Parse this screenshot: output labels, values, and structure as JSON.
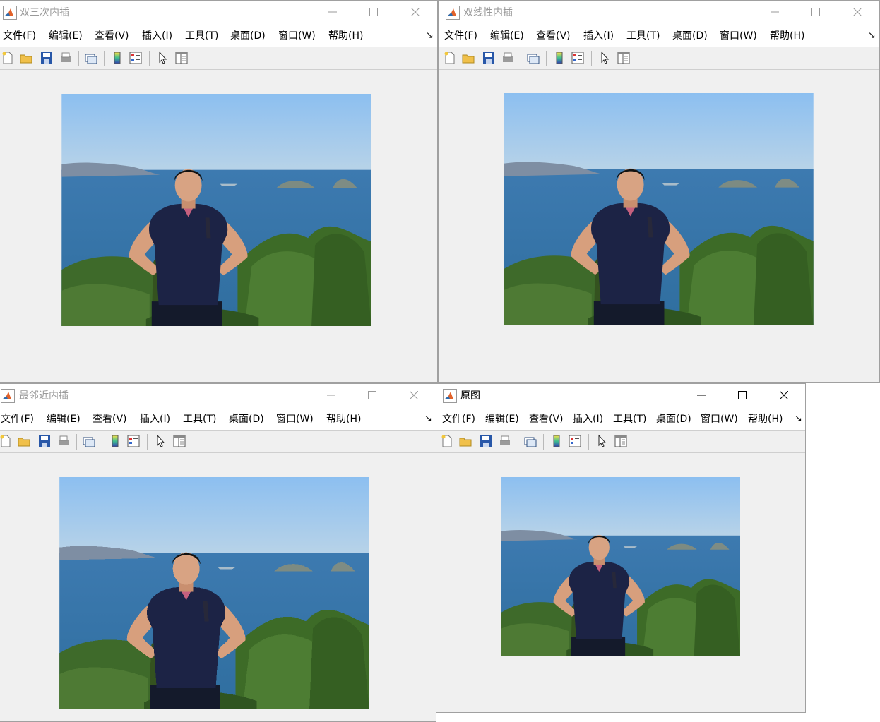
{
  "windows": {
    "bicubic": {
      "title": "双三次内插"
    },
    "bilinear": {
      "title": "双线性内插"
    },
    "nearest": {
      "title": "最邻近内插"
    },
    "original": {
      "title": "原图"
    }
  },
  "menu": {
    "file": "文件(F)",
    "edit": "编辑(E)",
    "view": "查看(V)",
    "insert": "插入(I)",
    "tools": "工具(T)",
    "desktop": "桌面(D)",
    "window": "窗口(W)",
    "help": "帮助(H)",
    "overflow": "↘"
  },
  "toolbar_icons": [
    "new-figure-icon",
    "open-file-icon",
    "save-icon",
    "print-icon",
    "link-plot-icon",
    "colorbar-icon",
    "legend-icon",
    "edit-plot-arrow-icon",
    "property-inspector-icon"
  ],
  "window_controls": [
    "minimize-icon",
    "maximize-icon",
    "close-icon"
  ],
  "colors": {
    "sky_top": "#8fc0f0",
    "sky_bottom": "#b6d3ea",
    "sea": "#3f7fb1",
    "shirt": "#1c2346",
    "foliage": "#3f6a28"
  }
}
